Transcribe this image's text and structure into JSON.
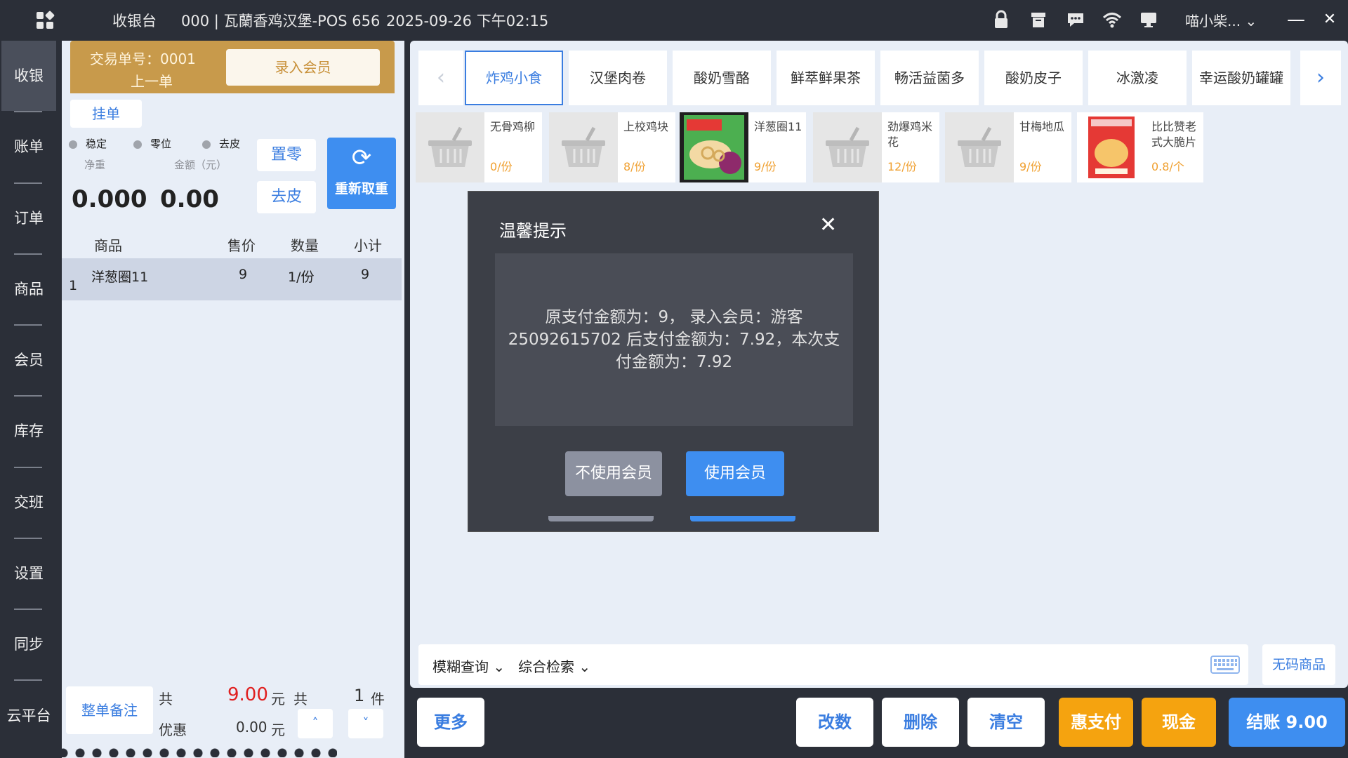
{
  "topbar": {
    "app_name": "收银台",
    "store": "000 | 瓦蘭香鸡汉堡-POS 656",
    "datetime": "2025-09-26 下午02:15",
    "user": "喵小柴...",
    "icons": [
      "lock-icon",
      "archive-icon",
      "message-icon",
      "wifi-icon",
      "monitor-icon"
    ],
    "minimize": "—",
    "close": "✕"
  },
  "leftnav": {
    "items": [
      "收银",
      "账单",
      "订单",
      "商品",
      "会员",
      "库存",
      "交班",
      "设置",
      "同步",
      "云平台"
    ],
    "active_index": 0
  },
  "cart": {
    "txn_label": "交易单号：",
    "txn_no": "0001",
    "prev_order": "上一单",
    "member_button": "录入会员",
    "hang_button": "挂单",
    "scale_status": {
      "stable": "稳定",
      "zero": "零位",
      "tare": "去皮"
    },
    "net_weight_label": "净重",
    "amount_label": "金额（元）",
    "net_weight": "0.000",
    "amount": "0.00",
    "zero_button": "置零",
    "tare_button": "去皮",
    "reweigh_button": "重新取重",
    "columns": [
      "商品",
      "售价",
      "数量",
      "小计"
    ],
    "rows": [
      {
        "index": "1",
        "name": "洋葱圈11",
        "price": "9",
        "qty": "1/份",
        "subtotal": "9"
      }
    ],
    "footer": {
      "note_button": "整单备注",
      "total_prefix": "共",
      "total_amount": "9.00",
      "yuan": "元",
      "count_prefix": "共",
      "count": "1",
      "count_unit": "件",
      "discount_label": "优惠",
      "discount_amount": "0.00",
      "up": "˄",
      "down": "˅"
    }
  },
  "categories": {
    "prev": "‹",
    "next": "›",
    "tabs": [
      "炸鸡小食",
      "汉堡肉卷",
      "酸奶雪酪",
      "鲜萃鲜果茶",
      "畅活益菌多",
      "酸奶皮子",
      "冰激凌",
      "幸运酸奶罐罐"
    ],
    "active_index": 0
  },
  "goods": [
    {
      "name": "无骨鸡柳",
      "price": "0/份",
      "image": "basket"
    },
    {
      "name": "上校鸡块",
      "price": "8/份",
      "image": "basket"
    },
    {
      "name": "洋葱圈11",
      "price": "9/份",
      "image": "onion-rings"
    },
    {
      "name": "劲爆鸡米花",
      "price": "12/份",
      "image": "basket"
    },
    {
      "name": "甘梅地瓜",
      "price": "9/份",
      "image": "basket"
    },
    {
      "name": "比比赞老式大脆片",
      "price": "0.8/个",
      "image": "snack-bag"
    }
  ],
  "search": {
    "mode1": "模糊查询",
    "mode2": "综合检索",
    "keyboard_icon": "keyboard-icon",
    "nocode_button": "无码商品"
  },
  "actions": {
    "more": "更多",
    "modify_qty": "改数",
    "delete": "删除",
    "clear": "清空",
    "hui_pay": "惠支付",
    "cash": "现金",
    "checkout": "结账 9.00"
  },
  "modal": {
    "title": "温馨提示",
    "close": "✕",
    "message": "原支付金额为：9，  录入会员：游客25092615702 后支付金额为：7.92，本次支付金额为：7.92",
    "no_member": "不使用会员",
    "use_member": "使用会员"
  },
  "colors": {
    "accent_blue": "#3e8ef0",
    "accent_orange": "#f5a30f",
    "gold_header": "#c89a4b",
    "price_red": "#e02020"
  }
}
